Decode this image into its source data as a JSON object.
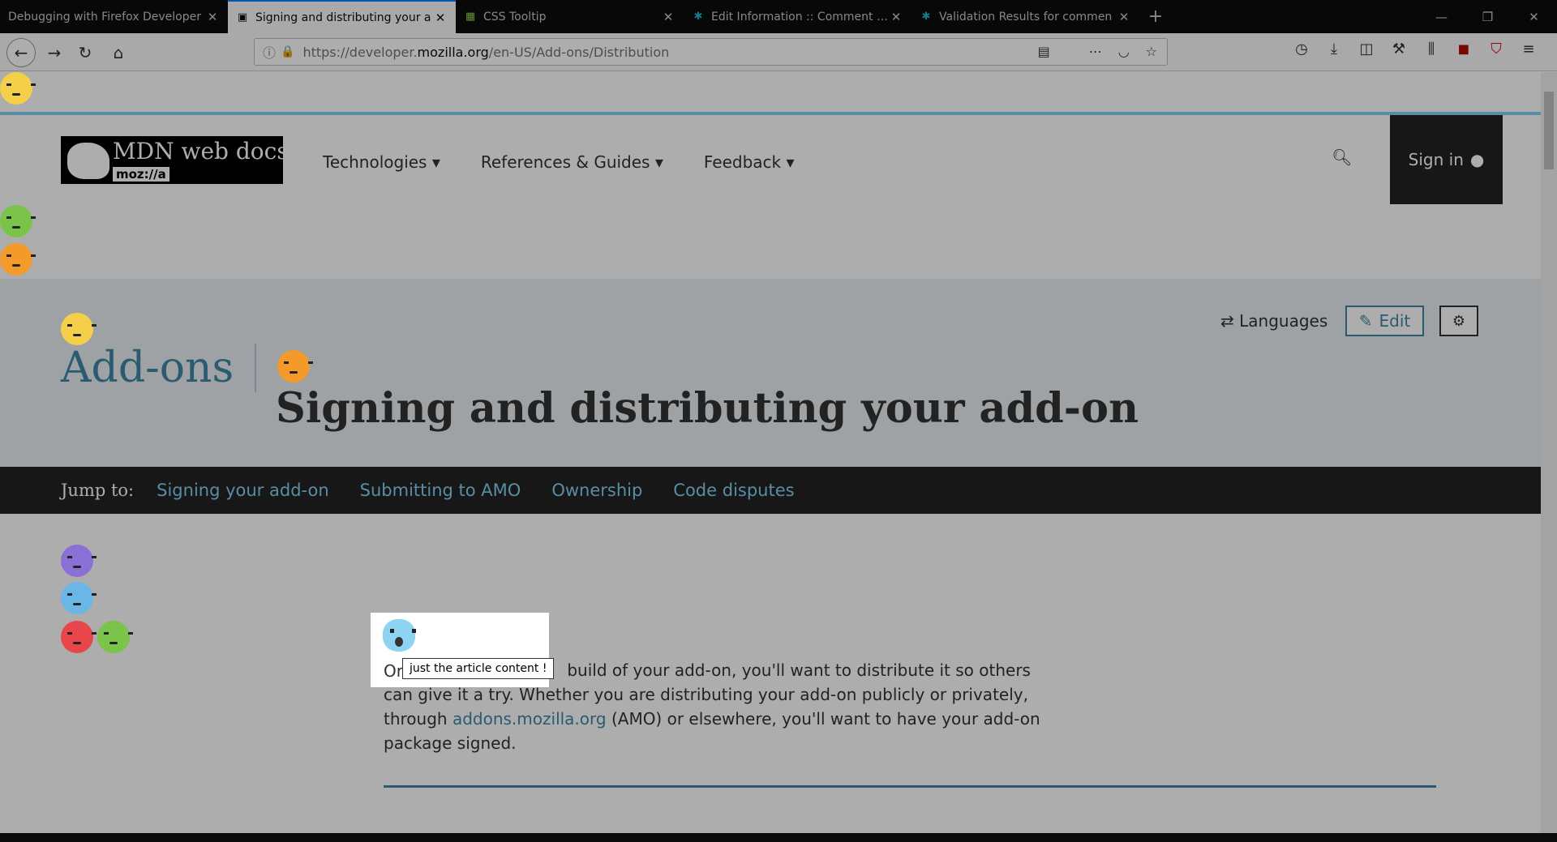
{
  "browser": {
    "tabs": [
      {
        "label": "Debugging with Firefox Developer",
        "active": false,
        "favicon": "firefox-icon"
      },
      {
        "label": "Signing and distributing your a",
        "active": true,
        "favicon": "mdn-icon"
      },
      {
        "label": "CSS Tooltip",
        "active": false,
        "favicon": "codepen-icon"
      },
      {
        "label": "Edit Information :: Comment Ca",
        "active": false,
        "favicon": "addons-icon"
      },
      {
        "label": "Validation Results for commen",
        "active": false,
        "favicon": "addons-icon"
      }
    ],
    "url_prefix": "https://developer.",
    "url_host": "mozilla.org",
    "url_path": "/en-US/Add-ons/Distribution"
  },
  "site": {
    "logo_title": "MDN web docs",
    "logo_sub": "moz://a",
    "nav": [
      "Technologies ▾",
      "References & Guides ▾",
      "Feedback ▾"
    ],
    "sign_in": "Sign in"
  },
  "hero": {
    "section": "Add-ons",
    "title": "Signing and distributing your add-on",
    "languages": "Languages",
    "edit": "Edit"
  },
  "jump": {
    "label": "Jump to:",
    "links": [
      "Signing your add-on",
      "Submitting to AMO",
      "Ownership",
      "Code disputes"
    ]
  },
  "article": {
    "intro_start": "Or",
    "intro_rest": "build of your add-on, you'll want to distribute it so others can give it a try. Whether you are distributing your add-on publicly or privately, through",
    "link": "addons.mozilla.org",
    "intro_end": "(AMO) or elsewhere, you'll want to have your add-on package signed."
  },
  "tour": {
    "tooltip": "just the article content !"
  },
  "colors": {
    "accent": "#3f87a6",
    "jumpbar_bg": "#222222",
    "hero_bg": "#eaeff2"
  }
}
